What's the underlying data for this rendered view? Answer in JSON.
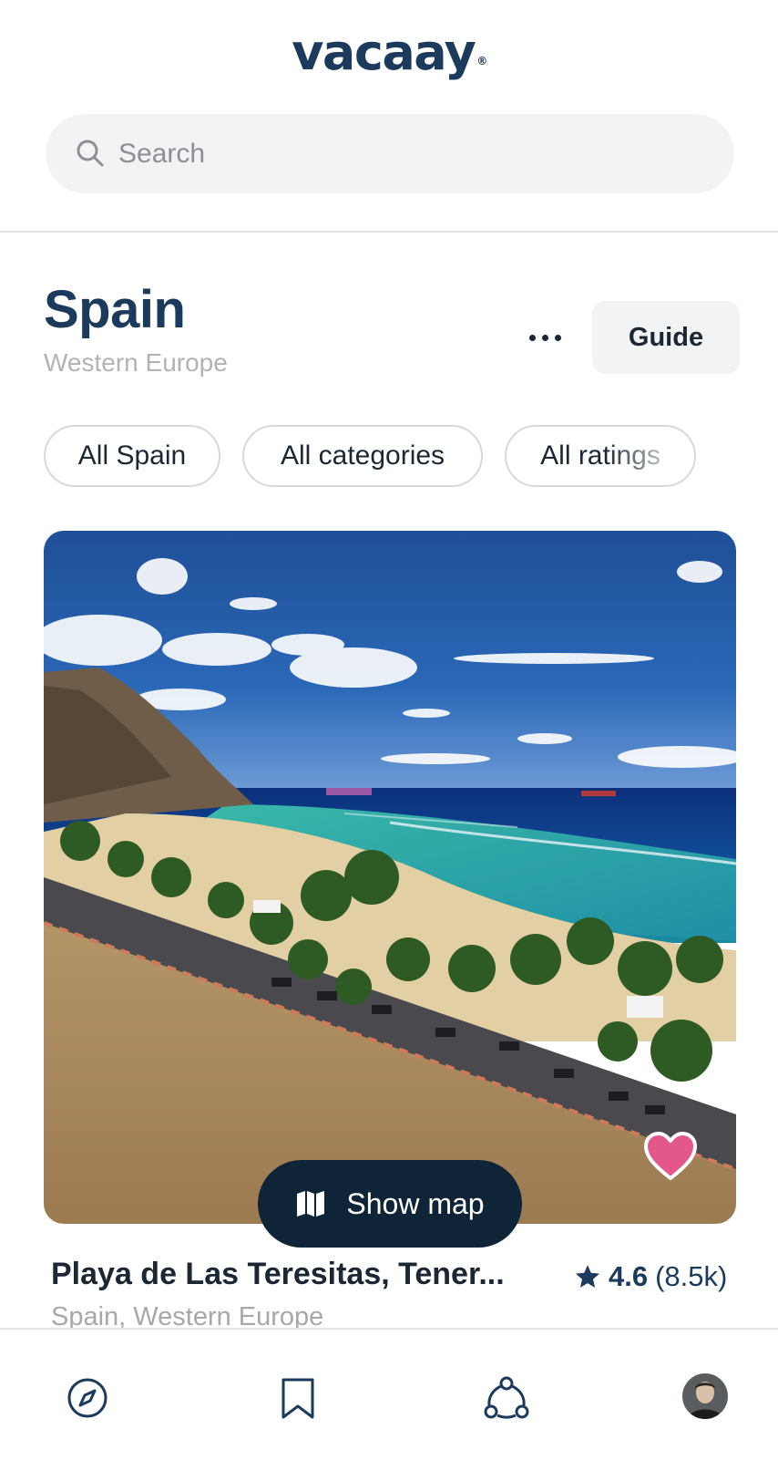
{
  "app": {
    "logo_text": "vacaay",
    "logo_mark": "®"
  },
  "search": {
    "placeholder": "Search",
    "value": ""
  },
  "page": {
    "title": "Spain",
    "subtitle": "Western Europe",
    "guide_label": "Guide",
    "more_icon": "more-horizontal-icon"
  },
  "filters": [
    {
      "label": "All Spain"
    },
    {
      "label": "All categories"
    },
    {
      "label": "All ratings"
    }
  ],
  "card": {
    "name": "Playa de Las Teresitas, Tener...",
    "location": "Spain, Western Europe",
    "rating": "4.6",
    "reviews": "(8.5k)",
    "favorited": true,
    "heart_color": "#e4578a"
  },
  "map_button": {
    "label": "Show map",
    "icon": "map-icon"
  },
  "nav": [
    {
      "id": "explore",
      "icon": "compass-icon"
    },
    {
      "id": "saved",
      "icon": "bookmark-icon"
    },
    {
      "id": "community",
      "icon": "community-icon"
    },
    {
      "id": "profile",
      "icon": "avatar"
    }
  ],
  "colors": {
    "brand": "#1b3a5c",
    "dark_button": "#0f2537",
    "chip_border": "#d7d9dc",
    "heart": "#e4578a"
  }
}
